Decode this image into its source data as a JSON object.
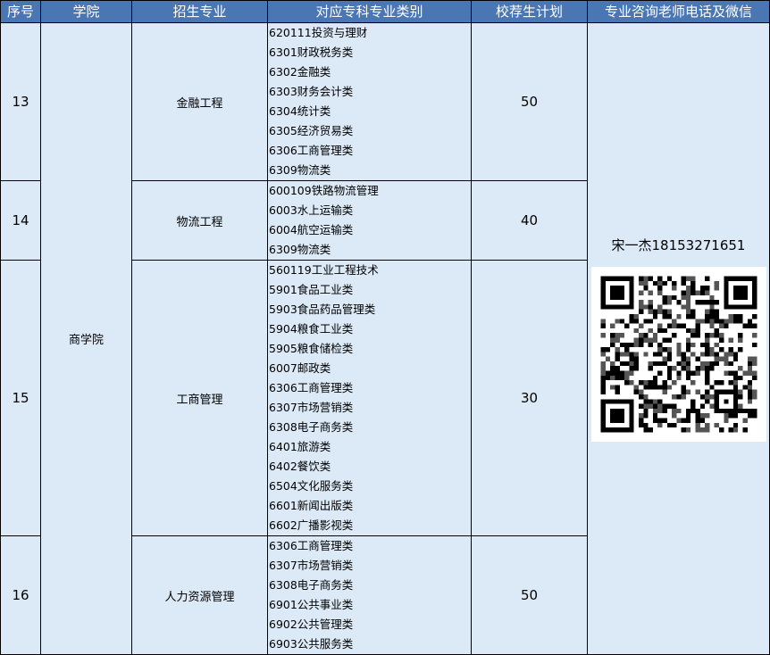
{
  "header": {
    "col_seq": "序号",
    "col_college": "学院",
    "col_major": "招生专业",
    "col_categories": "对应专科专业类别",
    "col_plan": "校荐生计划",
    "col_contact": "专业咨询老师电话及微信"
  },
  "college": "商学院",
  "contact": {
    "text": "宋一杰18153271651",
    "qr_icon": "wechat-qr-code-icon"
  },
  "rows": [
    {
      "seq": "13",
      "major": "金融工程",
      "plan": "50",
      "categories": [
        "620111投资与理财",
        "6301财政税务类",
        "6302金融类",
        "6303财务会计类",
        "6304统计类",
        "6305经济贸易类",
        "6306工商管理类",
        "6309物流类"
      ]
    },
    {
      "seq": "14",
      "major": "物流工程",
      "plan": "40",
      "categories": [
        "600109铁路物流管理",
        "6003水上运输类",
        "6004航空运输类",
        "6309物流类"
      ]
    },
    {
      "seq": "15",
      "major": "工商管理",
      "plan": "30",
      "categories": [
        "560119工业工程技术",
        "5901食品工业类",
        "5903食品药品管理类",
        "5904粮食工业类",
        "5905粮食储检类",
        "6007邮政类",
        "6306工商管理类",
        "6307市场营销类",
        "6308电子商务类",
        "6401旅游类",
        "6402餐饮类",
        "6504文化服务类",
        "6601新闻出版类",
        "6602广播影视类"
      ]
    },
    {
      "seq": "16",
      "major": "人力资源管理",
      "plan": "50",
      "categories": [
        "6306工商管理类",
        "6307市场营销类",
        "6308电子商务类",
        "6901公共事业类",
        "6902公共管理类",
        "6903公共服务类"
      ]
    }
  ]
}
